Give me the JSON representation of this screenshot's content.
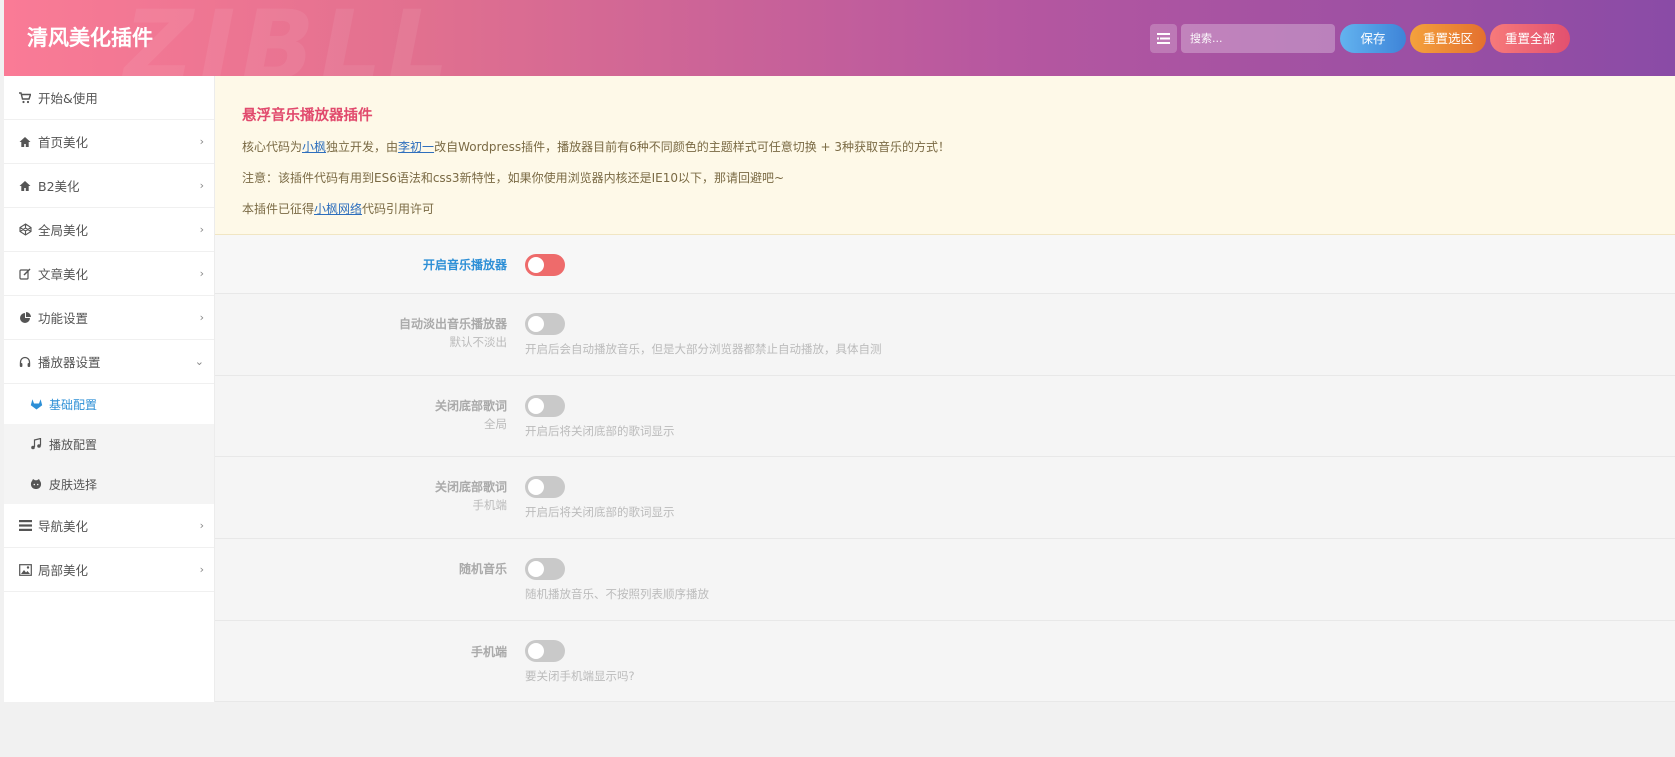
{
  "header": {
    "brand": "清风美化插件",
    "watermark": "ZIBLL",
    "search_placeholder": "搜索...",
    "save_label": "保存",
    "reset_section_label": "重置选区",
    "reset_all_label": "重置全部"
  },
  "sidebar": {
    "items": [
      {
        "label": "开始&使用",
        "icon": "cart-icon"
      },
      {
        "label": "首页美化",
        "icon": "home-icon"
      },
      {
        "label": "B2美化",
        "icon": "home-icon"
      },
      {
        "label": "全局美化",
        "icon": "codepen-icon"
      },
      {
        "label": "文章美化",
        "icon": "edit-icon"
      },
      {
        "label": "功能设置",
        "icon": "pie-chart-icon"
      },
      {
        "label": "播放器设置",
        "icon": "headphones-icon"
      }
    ],
    "sub_items": [
      {
        "label": "基础配置",
        "icon": "gitlab-icon"
      },
      {
        "label": "播放配置",
        "icon": "music-icon"
      },
      {
        "label": "皮肤选择",
        "icon": "github-icon"
      }
    ],
    "items_after": [
      {
        "label": "导航美化",
        "icon": "list-icon"
      },
      {
        "label": "局部美化",
        "icon": "image-icon"
      }
    ]
  },
  "notice": {
    "title": "悬浮音乐播放器插件",
    "line1_pre": "核心代码为",
    "line1_link1": "小枫",
    "line1_mid": "独立开发，由",
    "line1_link2": "李初一",
    "line1_post": "改自Wordpress插件，播放器目前有6种不同颜色的主题样式可任意切换 + 3种获取音乐的方式！",
    "line2": "注意：该插件代码有用到ES6语法和css3新特性，如果你使用浏览器内核还是IE10以下，那请回避吧~",
    "line3_pre": "本插件已征得",
    "line3_link": "小枫网络",
    "line3_post": "代码引用许可"
  },
  "settings": [
    {
      "label": "开启音乐播放器",
      "sub": "",
      "desc": "",
      "on": true
    },
    {
      "label": "自动淡出音乐播放器",
      "sub": "默认不淡出",
      "desc": "开启后会自动播放音乐，但是大部分浏览器都禁止自动播放，具体自测",
      "on": false
    },
    {
      "label": "关闭底部歌词",
      "sub": "全局",
      "desc": "开启后将关闭底部的歌词显示",
      "on": false
    },
    {
      "label": "关闭底部歌词",
      "sub": "手机端",
      "desc": "开启后将关闭底部的歌词显示",
      "on": false
    },
    {
      "label": "随机音乐",
      "sub": "",
      "desc": "随机播放音乐、不按照列表顺序播放",
      "on": false
    },
    {
      "label": "手机端",
      "sub": "",
      "desc": "要关闭手机端显示吗?",
      "on": false
    }
  ],
  "colors": {
    "accent_blue": "#2d8fd6",
    "notice_title": "#e14a6d",
    "toggle_on": "#ee6b6b",
    "toggle_off": "#c9c9c9"
  }
}
